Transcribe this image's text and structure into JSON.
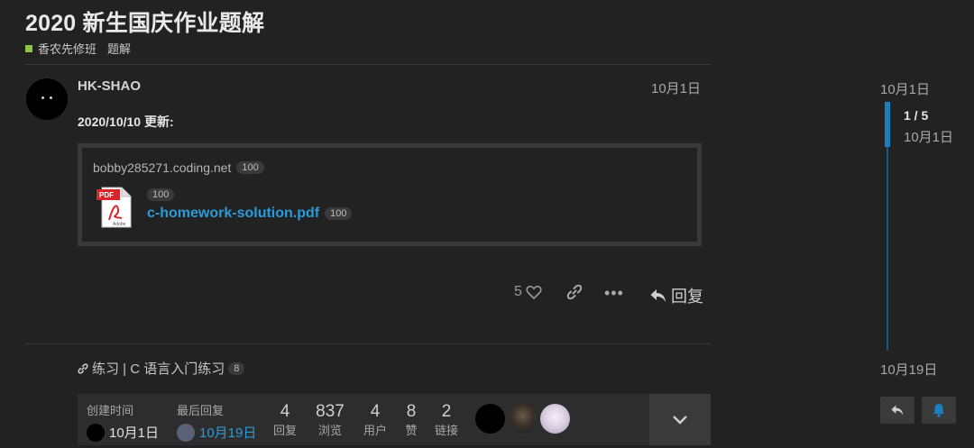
{
  "topic": {
    "title": "2020 新生国庆作业题解",
    "category": "香农先修班",
    "tag": "题解",
    "category_color": "#8dc63f"
  },
  "post": {
    "username": "HK-SHAO",
    "date": "10月1日",
    "update_line": "2020/10/10 更新:",
    "onebox": {
      "source": "bobby285271.coding.net",
      "source_clicks": "100",
      "file_icon": "pdf-icon",
      "file_clicks_top": "100",
      "file_name": "c-homework-solution.pdf",
      "file_clicks": "100"
    },
    "actions": {
      "like_count": "5",
      "reply_label": "回复"
    }
  },
  "linked_topic": {
    "text": "练习 | C 语言入门练习",
    "count": "8"
  },
  "footer": {
    "created_label": "创建时间",
    "created_value": "10月1日",
    "last_reply_label": "最后回复",
    "last_reply_value": "10月19日",
    "stats": [
      {
        "num": "4",
        "cap": "回复"
      },
      {
        "num": "837",
        "cap": "浏览"
      },
      {
        "num": "4",
        "cap": "用户"
      },
      {
        "num": "8",
        "cap": "赞"
      },
      {
        "num": "2",
        "cap": "链接"
      }
    ]
  },
  "timeline": {
    "start_date": "10月1日",
    "position": "1 / 5",
    "position_date": "10月1日",
    "end_date": "10月19日"
  },
  "colors": {
    "link": "#2a9bd9",
    "accent": "#1a7fbf",
    "background": "#222222"
  }
}
